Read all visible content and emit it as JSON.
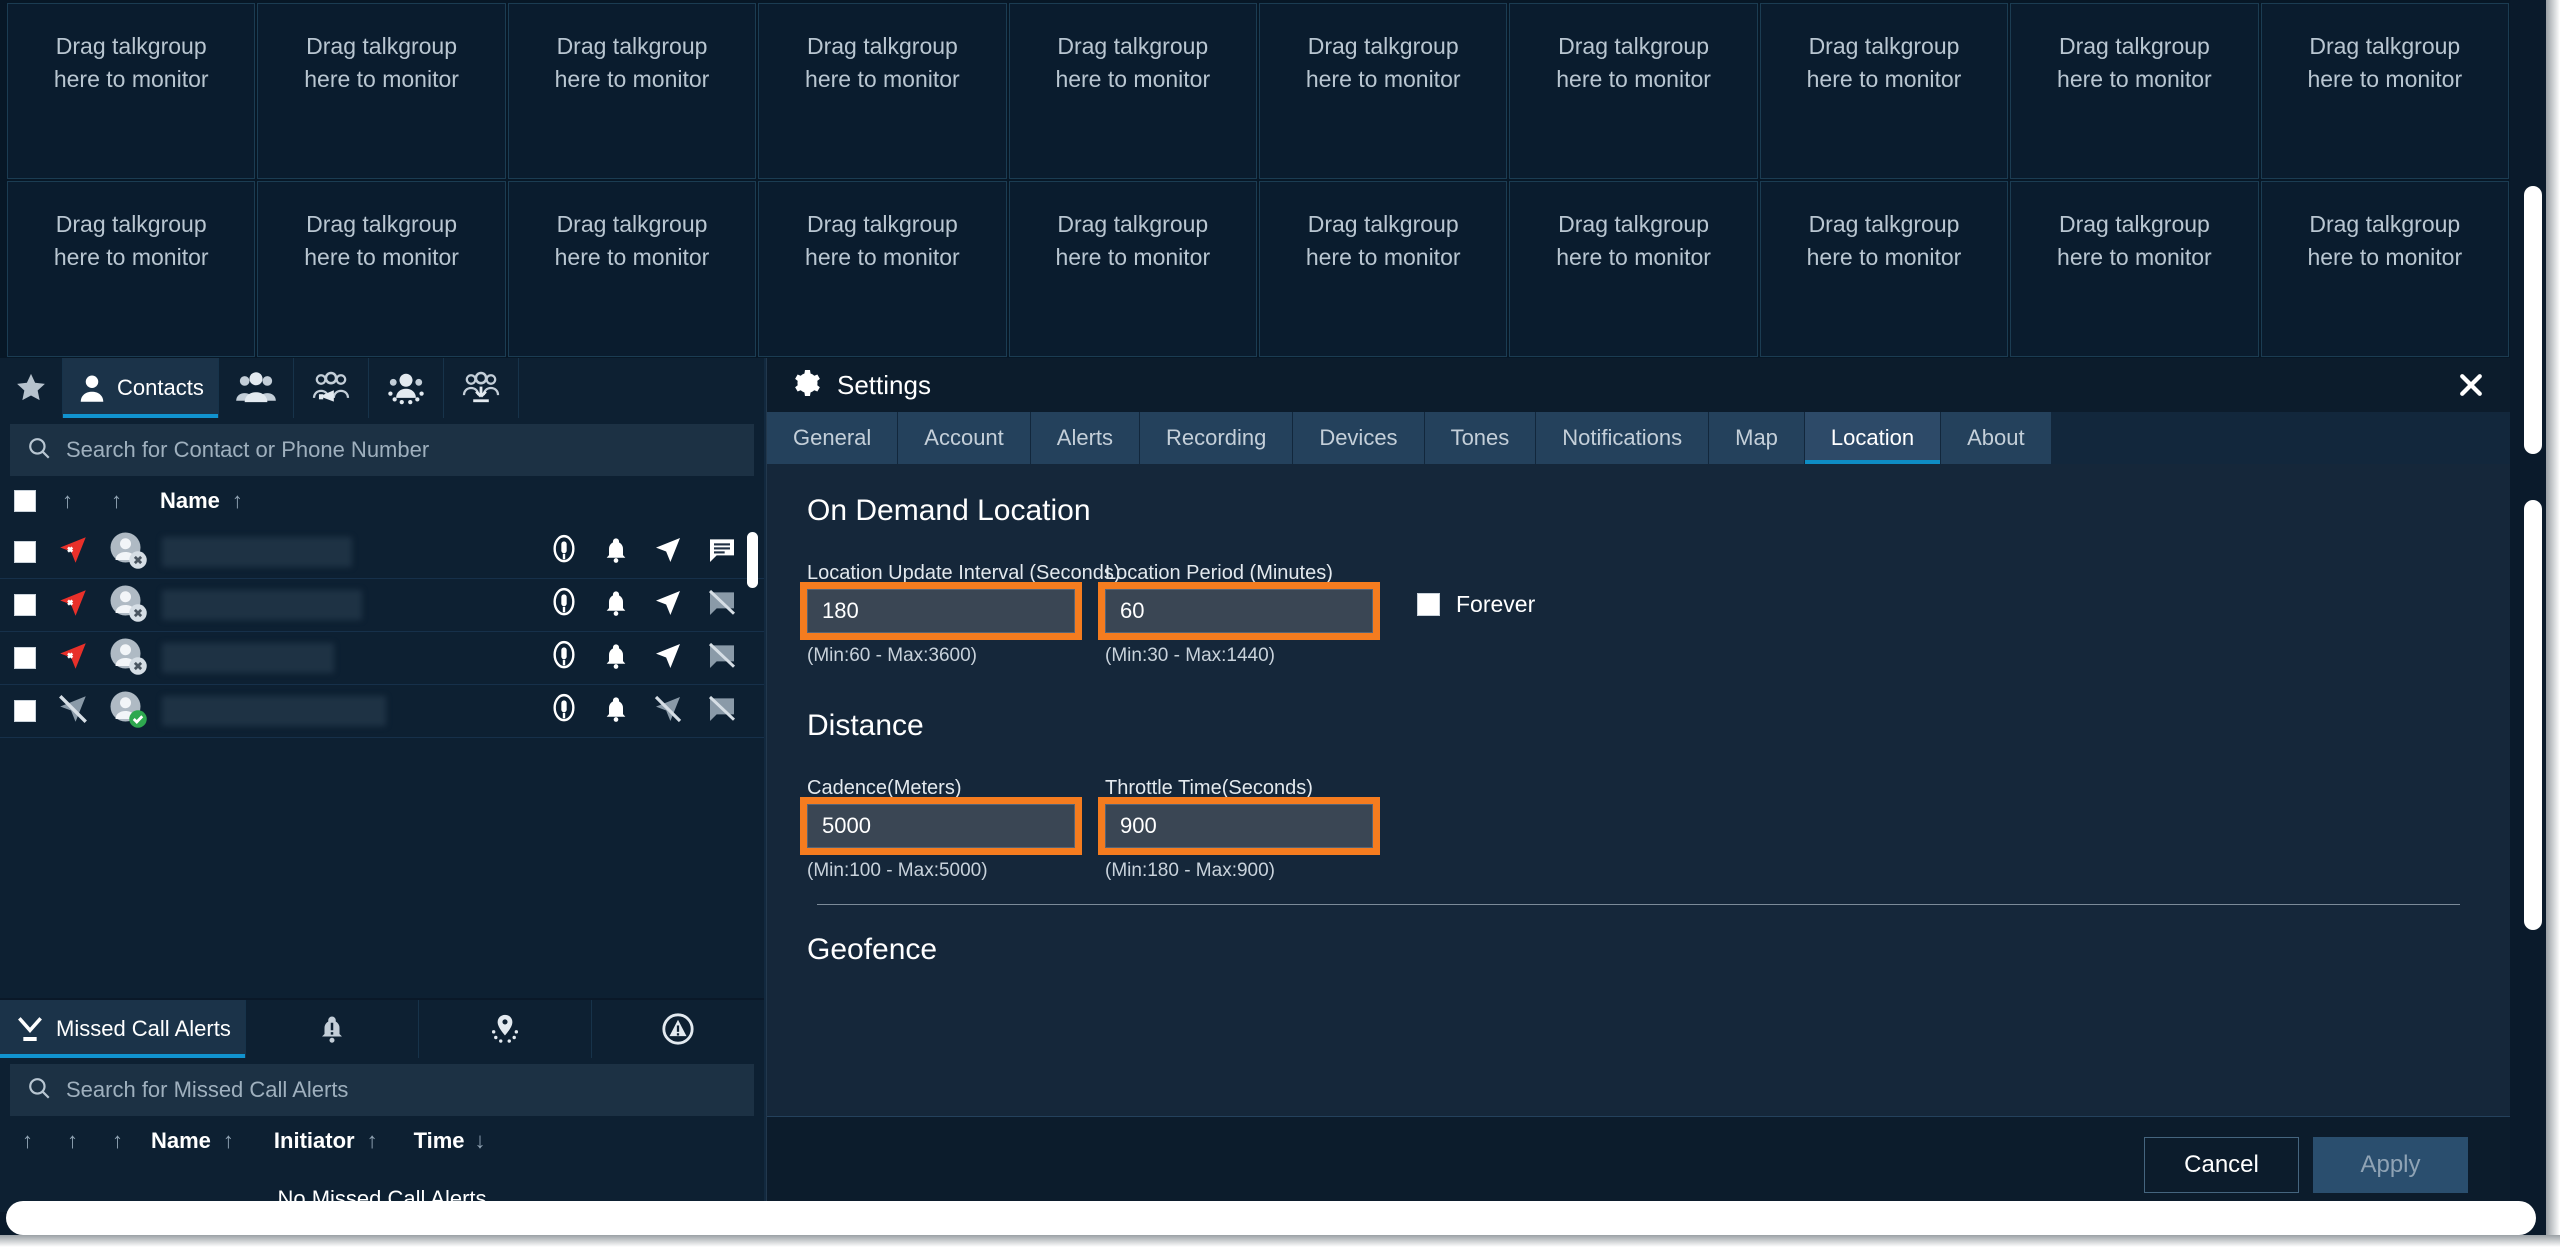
{
  "talkgroups": {
    "tile_line1": "Drag talkgroup",
    "tile_line2": "here to monitor",
    "count": 20
  },
  "contacts_panel": {
    "tabs": [
      {
        "label": "",
        "icon": "star-icon",
        "active": false
      },
      {
        "label": "Contacts",
        "icon": "person-icon",
        "active": true
      },
      {
        "label": "",
        "icon": "talkgroups-icon",
        "active": false
      },
      {
        "label": "",
        "icon": "broadcast-group-icon",
        "active": false
      },
      {
        "label": "",
        "icon": "dynamic-group-icon",
        "active": false
      },
      {
        "label": "",
        "icon": "group-download-icon",
        "active": false
      }
    ],
    "search_placeholder": "Search for Contact or Phone Number",
    "columns": [
      "",
      "",
      "",
      "Name"
    ],
    "rows": [
      {
        "presence": "available",
        "location": "location-off",
        "name": ""
      },
      {
        "presence": "offline",
        "location": "location-denied",
        "name": ""
      },
      {
        "presence": "offline",
        "location": "location-denied",
        "name": ""
      },
      {
        "presence": "offline",
        "location": "location-denied",
        "name": ""
      }
    ]
  },
  "missed_calls_panel": {
    "tabs": [
      {
        "label": "Missed Call Alerts",
        "icon": "missed-call-icon",
        "active": true
      },
      {
        "label": "",
        "icon": "alert-bell-icon",
        "active": false
      },
      {
        "label": "",
        "icon": "geofence-pin-icon",
        "active": false
      },
      {
        "label": "",
        "icon": "emergency-icon",
        "active": false
      }
    ],
    "search_placeholder": "Search for Missed Call Alerts",
    "columns": [
      "Name",
      "Initiator",
      "Time"
    ],
    "empty_text": "No Missed Call Alerts"
  },
  "settings": {
    "title": "Settings",
    "tabs": [
      "General",
      "Account",
      "Alerts",
      "Recording",
      "Devices",
      "Tones",
      "Notifications",
      "Map",
      "Location",
      "About"
    ],
    "active_tab": "Location",
    "sections": {
      "on_demand_location": {
        "title": "On Demand Location",
        "fields": [
          {
            "label": "Location Update Interval (Seconds)",
            "value": "180",
            "hint": "(Min:60 - Max:3600)",
            "highlighted": true
          },
          {
            "label": "Location Period (Minutes)",
            "value": "60",
            "hint": "(Min:30 - Max:1440)",
            "highlighted": true
          }
        ],
        "forever_label": "Forever",
        "forever_checked": false
      },
      "distance": {
        "title": "Distance",
        "fields": [
          {
            "label": "Cadence(Meters)",
            "value": "5000",
            "hint": "(Min:100 - Max:5000)",
            "highlighted": true
          },
          {
            "label": "Throttle Time(Seconds)",
            "value": "900",
            "hint": "(Min:180 - Max:900)",
            "highlighted": true
          }
        ]
      },
      "geofence": {
        "title": "Geofence"
      }
    },
    "footer": {
      "cancel_label": "Cancel",
      "apply_label": "Apply"
    }
  },
  "colors": {
    "highlight_orange": "#F57C1F",
    "accent_cyan": "#0E8CC4",
    "dialog_bg": "#15273A",
    "panel_bg": "#0D2032",
    "tile_bg": "#0A1C2E",
    "input_bg": "#3A4654",
    "presence_available": "#2EA84F",
    "location_denied": "#E8302A"
  }
}
